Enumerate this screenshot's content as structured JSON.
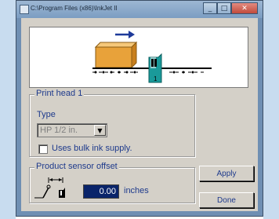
{
  "window": {
    "title": "C:\\Program Files (x86)\\InkJet II"
  },
  "title_controls": {
    "minimize": "_",
    "maximize": "□",
    "close": "✕"
  },
  "illustration": {
    "sensor_number": "1"
  },
  "print_head": {
    "group_title": "Print head 1",
    "type_label": "Type",
    "type_value": "HP 1/2 in.",
    "dropdown_glyph": "▼",
    "bulk_ink_label": "Uses bulk ink supply.",
    "bulk_ink_checked": false
  },
  "sensor": {
    "group_title": "Product sensor offset",
    "offset_value": "0.00",
    "unit": "inches"
  },
  "buttons": {
    "apply": "Apply",
    "done": "Done"
  },
  "colors": {
    "label_text": "#1e3a8c",
    "illustration_box": "#e8a23a",
    "sensor_head": "#1a9a9a",
    "arrow": "#1e3a9a"
  }
}
